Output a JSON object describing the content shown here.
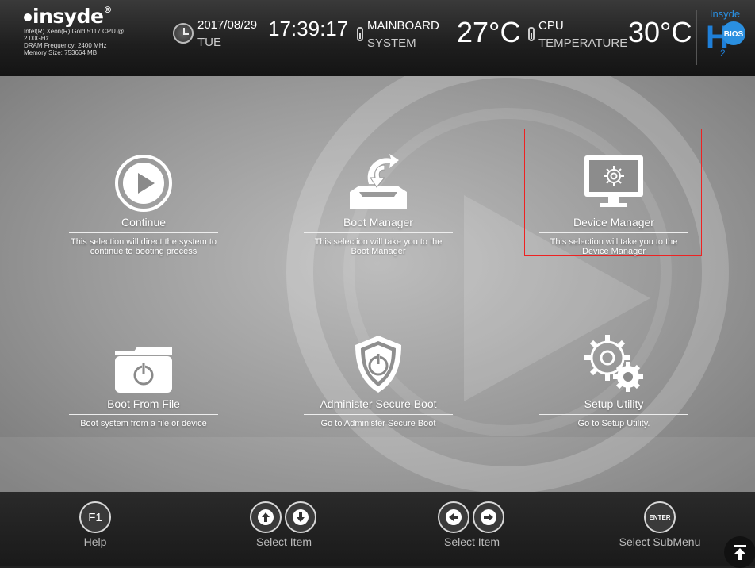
{
  "header": {
    "logo": "insyde",
    "sysinfo": [
      "Intel(R) Xeon(R) Gold 5117 CPU @",
      "2.00GHz",
      "DRAM Frequency: 2400 MHz",
      "Memory Size: 753664 MB"
    ],
    "date": "2017/08/29",
    "day": "TUE",
    "time": "17:39:17",
    "mainboard_label1": "MAINBOARD",
    "mainboard_label2": "SYSTEM",
    "mainboard_temp": "27°C",
    "cpu_label1": "CPU",
    "cpu_label2": "TEMPERATURE",
    "cpu_temp": "30°C",
    "h2o_top": "Insyde",
    "h2o_bios": "BIOS",
    "h2o_h": "H",
    "h2o_2": "2"
  },
  "menu": [
    {
      "title": "Continue",
      "desc": "This selection will direct the system to continue to booting process",
      "icon": "play-icon",
      "selected": false
    },
    {
      "title": "Boot Manager",
      "desc": "This selection will take you to the Boot Manager",
      "icon": "boot-manager-icon",
      "selected": false
    },
    {
      "title": "Device Manager",
      "desc": "This selection will take you to the Device Manager",
      "icon": "monitor-gear-icon",
      "selected": true
    },
    {
      "title": "Boot From File",
      "desc": "Boot system from a file or device",
      "icon": "folder-power-icon",
      "selected": false
    },
    {
      "title": "Administer Secure Boot",
      "desc": "Go to Administer Secure Boot",
      "icon": "shield-power-icon",
      "selected": false
    },
    {
      "title": "Setup Utility",
      "desc": "Go to Setup Utility.",
      "icon": "gears-icon",
      "selected": false
    }
  ],
  "footer": {
    "f1_key": "F1",
    "help": "Help",
    "select_item_1": "Select Item",
    "select_item_2": "Select Item",
    "enter_key": "ENTER",
    "select_submenu": "Select  SubMenu"
  },
  "colors": {
    "selection_border": "#e22222"
  }
}
